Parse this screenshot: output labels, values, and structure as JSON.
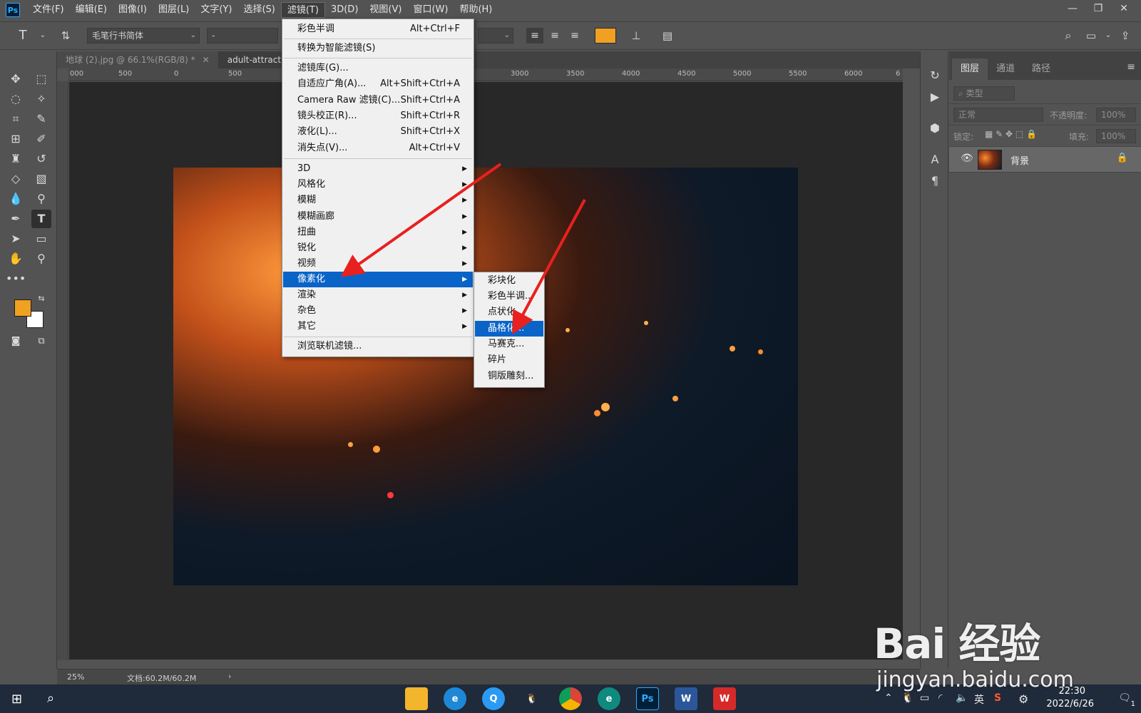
{
  "app": {
    "logo": "Ps"
  },
  "menubar": {
    "items": [
      {
        "label": "文件(F)"
      },
      {
        "label": "编辑(E)"
      },
      {
        "label": "图像(I)"
      },
      {
        "label": "图层(L)"
      },
      {
        "label": "文字(Y)"
      },
      {
        "label": "选择(S)"
      },
      {
        "label": "滤镜(T)"
      },
      {
        "label": "3D(D)"
      },
      {
        "label": "视图(V)"
      },
      {
        "label": "窗口(W)"
      },
      {
        "label": "帮助(H)"
      }
    ],
    "active_index": 6
  },
  "window_controls": {
    "minimize": "—",
    "restore": "❐",
    "close": "✕"
  },
  "options_bar": {
    "tool_icon": "T",
    "font_family": "毛笔行书简体",
    "font_style": "-",
    "swatch_color": "#f0a122"
  },
  "tabs": [
    {
      "label": "地球 (2).jpg @ 66.1%(RGB/8) *",
      "close": "✕"
    },
    {
      "label": "adult-attractive"
    }
  ],
  "ruler_top_labels": [
    "000",
    "500",
    "0",
    "500",
    "3000",
    "3500",
    "4000",
    "4500",
    "5000",
    "5500",
    "6000",
    "6"
  ],
  "colors": {
    "foreground": "#f0a122",
    "background": "#ffffff",
    "highlight": "#0a64c8",
    "arrow": "#e8211f"
  },
  "filter_menu": {
    "items": [
      {
        "label": "彩色半调",
        "shortcut": "Alt+Ctrl+F"
      },
      {
        "label": "转换为智能滤镜(S)"
      },
      {
        "label": "滤镜库(G)..."
      },
      {
        "label": "自适应广角(A)...",
        "shortcut": "Alt+Shift+Ctrl+A"
      },
      {
        "label": "Camera Raw 滤镜(C)...",
        "shortcut": "Shift+Ctrl+A"
      },
      {
        "label": "镜头校正(R)...",
        "shortcut": "Shift+Ctrl+R"
      },
      {
        "label": "液化(L)...",
        "shortcut": "Shift+Ctrl+X"
      },
      {
        "label": "消失点(V)...",
        "shortcut": "Alt+Ctrl+V"
      },
      {
        "label": "3D",
        "submenu": true
      },
      {
        "label": "风格化",
        "submenu": true
      },
      {
        "label": "模糊",
        "submenu": true
      },
      {
        "label": "模糊画廊",
        "submenu": true
      },
      {
        "label": "扭曲",
        "submenu": true
      },
      {
        "label": "锐化",
        "submenu": true
      },
      {
        "label": "视频",
        "submenu": true
      },
      {
        "label": "像素化",
        "submenu": true,
        "highlighted": true
      },
      {
        "label": "渲染",
        "submenu": true
      },
      {
        "label": "杂色",
        "submenu": true
      },
      {
        "label": "其它",
        "submenu": true
      },
      {
        "label": "浏览联机滤镜..."
      }
    ]
  },
  "pixelate_submenu": {
    "items": [
      {
        "label": "彩块化"
      },
      {
        "label": "彩色半调..."
      },
      {
        "label": "点状化..."
      },
      {
        "label": "晶格化...",
        "highlighted": true
      },
      {
        "label": "马赛克..."
      },
      {
        "label": "碎片"
      },
      {
        "label": "铜版雕刻..."
      }
    ]
  },
  "layers_panel": {
    "tabs": [
      "图层",
      "通道",
      "路径"
    ],
    "active_tab": 0,
    "filter_placeholder": "类型",
    "blend_mode": "正常",
    "opacity_label": "不透明度:",
    "opacity_value": "100%",
    "lock_label": "锁定:",
    "fill_label": "填充:",
    "fill_value": "100%",
    "layer": {
      "name": "背景"
    }
  },
  "status_bar": {
    "zoom": "25%",
    "doc_info": "文档:60.2M/60.2M",
    "arrow": "›"
  },
  "watermark": {
    "main": "Bai 经验",
    "sub": "jingyan.baidu.com"
  },
  "taskbar": {
    "apps": [
      {
        "name": "file-explorer",
        "label": "",
        "color": "#f2b52c"
      },
      {
        "name": "browser-e",
        "label": "e",
        "color": "#1e88d6"
      },
      {
        "name": "qq-browser",
        "label": "Q",
        "color": "#2b9af3"
      },
      {
        "name": "qq",
        "label": "🐧",
        "color": "#1f2a3a"
      },
      {
        "name": "chrome",
        "label": "●",
        "color": "#db4437"
      },
      {
        "name": "edge",
        "label": "e",
        "color": "#0f8a7e"
      },
      {
        "name": "photoshop",
        "label": "Ps",
        "color": "#001e36"
      },
      {
        "name": "word",
        "label": "W",
        "color": "#2b579a"
      },
      {
        "name": "wps",
        "label": "W",
        "color": "#d42a2a"
      }
    ],
    "tray": {
      "ime": "英",
      "time": "22:30",
      "date": "2022/6/26",
      "notify": "1"
    }
  }
}
